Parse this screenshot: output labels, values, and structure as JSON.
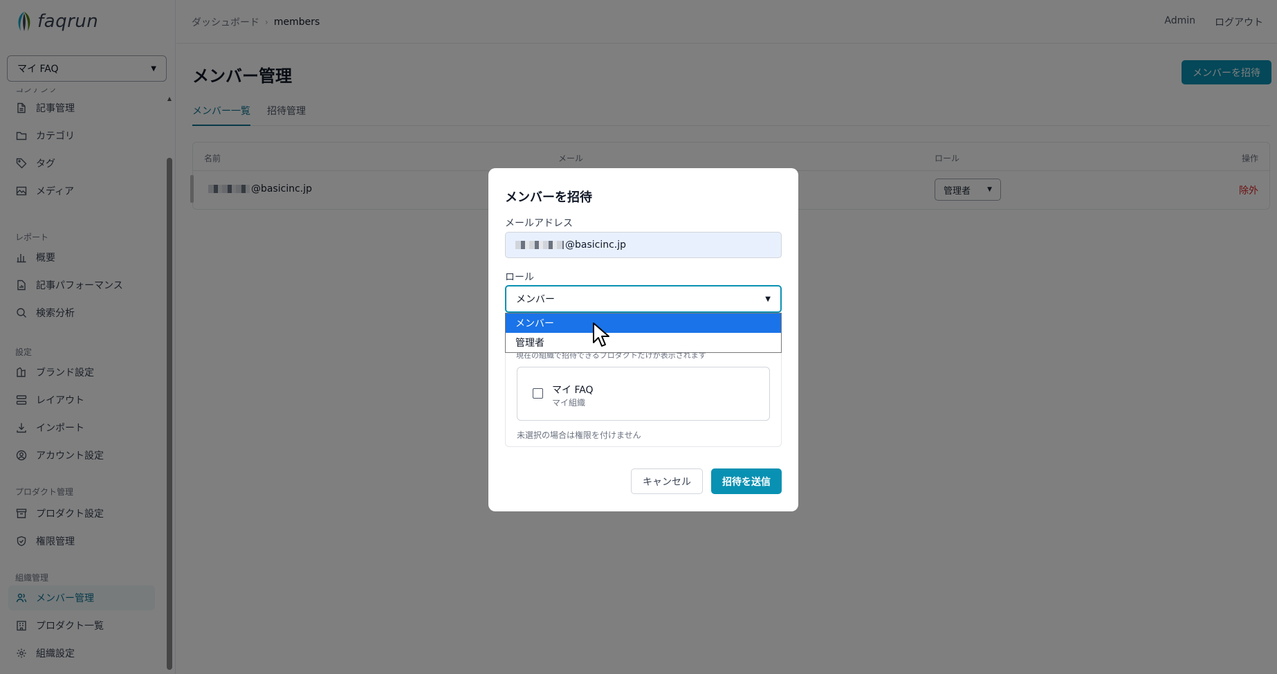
{
  "app": {
    "logo_text": "faqrun"
  },
  "sidebar": {
    "org_select": "マイ FAQ",
    "sections": {
      "content": "コンテンツ",
      "report": "レポート",
      "settings": "設定",
      "product": "プロダクト管理",
      "org": "組織管理"
    },
    "items": [
      {
        "label": "記事管理",
        "icon": "document-icon"
      },
      {
        "label": "カテゴリ",
        "icon": "folder-icon"
      },
      {
        "label": "タグ",
        "icon": "tag-icon"
      },
      {
        "label": "メディア",
        "icon": "image-icon"
      },
      {
        "label": "概要",
        "icon": "bar-chart-icon"
      },
      {
        "label": "記事パフォーマンス",
        "icon": "document-chart-icon"
      },
      {
        "label": "検索分析",
        "icon": "search-icon"
      },
      {
        "label": "ブランド設定",
        "icon": "palette-icon"
      },
      {
        "label": "レイアウト",
        "icon": "layout-icon"
      },
      {
        "label": "インポート",
        "icon": "download-icon"
      },
      {
        "label": "アカウント設定",
        "icon": "user-circle-icon"
      },
      {
        "label": "プロダクト設定",
        "icon": "archive-icon"
      },
      {
        "label": "権限管理",
        "icon": "shield-icon"
      },
      {
        "label": "メンバー管理",
        "icon": "users-icon"
      },
      {
        "label": "プロダクト一覧",
        "icon": "building-icon"
      },
      {
        "label": "組織設定",
        "icon": "gear-icon"
      }
    ]
  },
  "header": {
    "breadcrumb_root": "ダッシュボード",
    "breadcrumb_current": "members",
    "admin": "Admin",
    "logout": "ログアウト"
  },
  "main": {
    "title": "メンバー管理",
    "invite_button": "メンバーを招待",
    "tabs": [
      "メンバー一覧",
      "招待管理"
    ],
    "table": {
      "headers": {
        "name": "名前",
        "email": "メール",
        "role": "ロール",
        "action": "操作"
      },
      "rows": [
        {
          "name_suffix": "@basicinc.jp",
          "role": "管理者",
          "action": "除外"
        }
      ]
    }
  },
  "modal": {
    "title": "メンバーを招待",
    "email_label": "メールアドレス",
    "email_value_suffix": "@basicinc.jp",
    "role_label": "ロール",
    "role_value": "メンバー",
    "role_options": [
      "メンバー",
      "管理者"
    ],
    "permission_hint": "現在の組織で招待できるプロダクトだけが表示されます",
    "product_name": "マイ FAQ",
    "product_org": "マイ組織",
    "permission_note": "未選択の場合は権限を付けません",
    "cancel": "キャンセル",
    "submit": "招待を送信"
  },
  "colors": {
    "accent": "#0891b2",
    "danger": "#dc2626",
    "selected_option": "#1a73e8"
  }
}
